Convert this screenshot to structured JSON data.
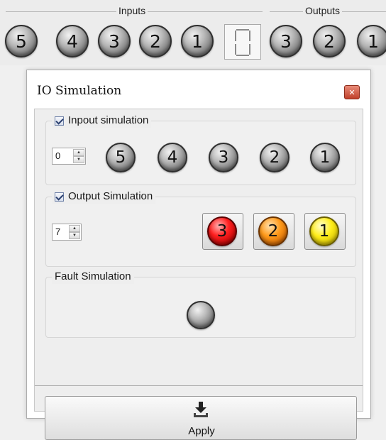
{
  "top_panel": {
    "inputs_label": "Inputs",
    "outputs_label": "Outputs",
    "input_leds": [
      "5",
      "4",
      "3",
      "2",
      "1"
    ],
    "output_leds": [
      "3",
      "2",
      "1"
    ],
    "display_value": "0"
  },
  "dialog": {
    "title": "IO Simulation",
    "close_icon": "close-icon",
    "input_simulation": {
      "label": "Inpout simulation",
      "checked": true,
      "value": "0",
      "leds": [
        "5",
        "4",
        "3",
        "2",
        "1"
      ]
    },
    "output_simulation": {
      "label": "Output Simulation",
      "checked": true,
      "value": "7",
      "leds": [
        {
          "label": "3",
          "color": "#ff2020"
        },
        {
          "label": "2",
          "color": "#ff9a1a"
        },
        {
          "label": "1",
          "color": "#ffee1a"
        }
      ]
    },
    "fault_simulation": {
      "label": "Fault Simulation"
    },
    "apply_button": {
      "label": "Apply",
      "icon": "download-icon"
    }
  }
}
